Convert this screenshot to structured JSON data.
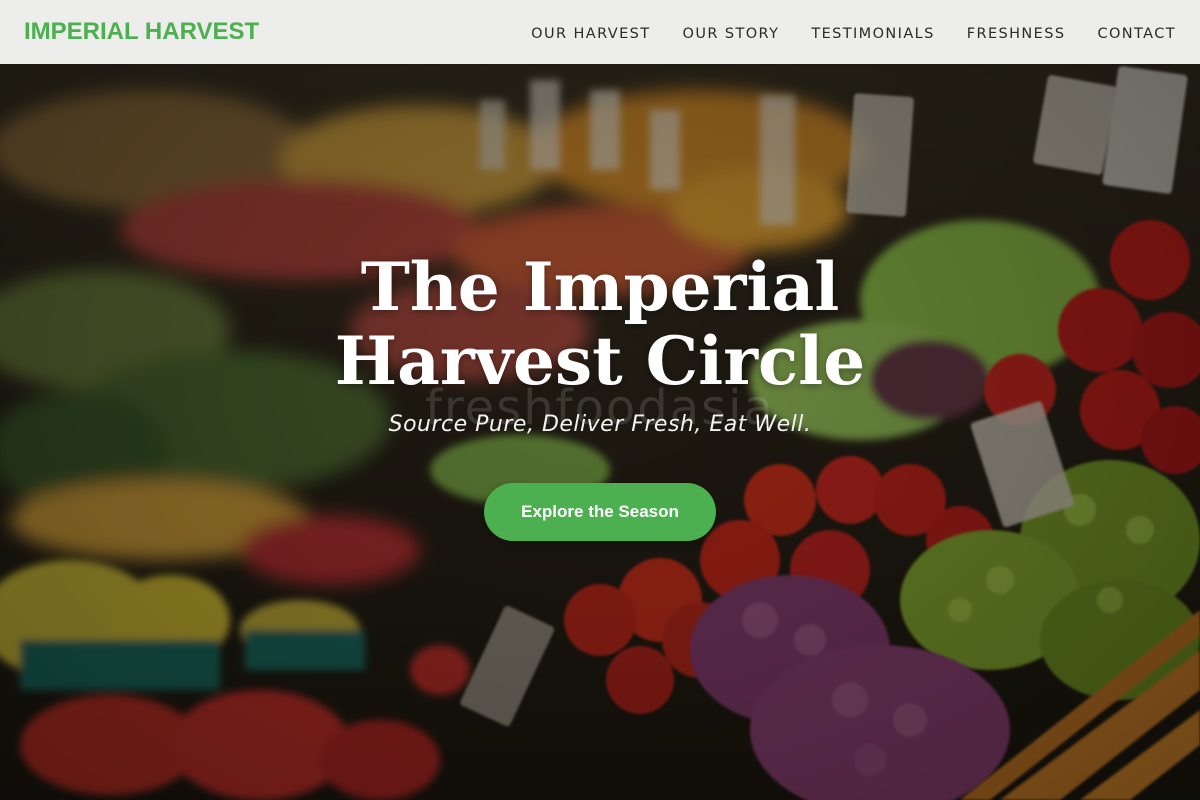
{
  "navbar": {
    "logo": "IMPERIAL HARVEST",
    "links": [
      {
        "label": "OUR HARVEST"
      },
      {
        "label": "OUR STORY"
      },
      {
        "label": "TESTIMONIALS"
      },
      {
        "label": "FRESHNESS"
      },
      {
        "label": "CONTACT"
      }
    ]
  },
  "hero": {
    "title": "The Imperial Harvest Circle",
    "watermark": "freshfoodasia",
    "tagline": "Source Pure, Deliver Fresh, Eat Well.",
    "cta_label": "Explore the Season"
  },
  "colors": {
    "brand": "#4caf50",
    "navbar_bg": "#f6f6f6",
    "nav_text": "#2b2b2b",
    "hero_text": "#ffffff"
  }
}
